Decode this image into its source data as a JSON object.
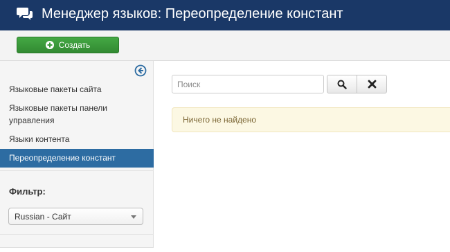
{
  "header": {
    "title": "Менеджер языков: Переопределение констант",
    "icon": "comments-icon"
  },
  "toolbar": {
    "create_label": "Создать"
  },
  "sidebar": {
    "items": [
      {
        "label": "Языковые пакеты сайта",
        "active": false
      },
      {
        "label": "Языковые пакеты панели управления",
        "active": false
      },
      {
        "label": "Языки контента",
        "active": false
      },
      {
        "label": "Переопределение констант",
        "active": true
      }
    ],
    "filter_label": "Фильтр:",
    "filter_select_value": "Russian - Сайт"
  },
  "search": {
    "placeholder": "Поиск",
    "value": ""
  },
  "alert": {
    "message": "Ничего не найдено"
  },
  "colors": {
    "header_bg": "#1a3867",
    "create_button": "#3b9b3b",
    "active_nav": "#2d6ca2",
    "alert_bg": "#fcf8e3"
  }
}
